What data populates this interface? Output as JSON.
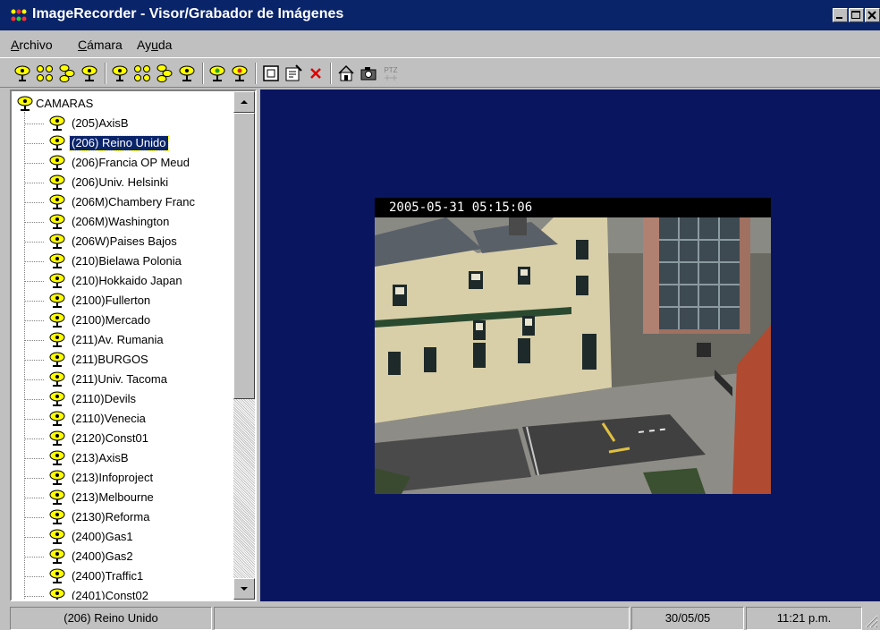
{
  "window": {
    "title": "ImageRecorder - Visor/Grabador de Imágenes",
    "icons": [
      "app-icon",
      "minimize-icon",
      "maximize-icon",
      "close-icon"
    ]
  },
  "menu": [
    {
      "label_ul": "A",
      "label_rest": "rchivo"
    },
    {
      "label_ul": "C",
      "label_rest": "ámara"
    },
    {
      "label_pre": "Ay",
      "label_ul": "u",
      "label_rest": "da"
    }
  ],
  "toolbar": {
    "buttons": [
      "camera-add-icon",
      "cameras-group-icon",
      "cameras-cascade-icon",
      "camera-single-icon",
      "camera-add-icon",
      "cameras-group-icon",
      "cameras-cascade-icon",
      "camera-single-icon",
      "camera-connect-icon",
      "camera-disconnect-icon",
      "fit-window-icon",
      "properties-icon",
      "delete-icon",
      "home-icon",
      "snapshot-icon",
      "ptz-icon"
    ],
    "ptz_label": "PTZ"
  },
  "tree": {
    "root": "CAMARAS",
    "selected": "(206) Reino Unido",
    "items": [
      "(205)AxisB",
      "(206) Reino Unido",
      "(206)Francia OP Meud",
      "(206)Univ. Helsinki",
      "(206M)Chambery Franc",
      "(206M)Washington",
      "(206W)Paises Bajos",
      "(210)Bielawa Polonia",
      "(210)Hokkaido Japan",
      "(2100)Fullerton",
      "(2100)Mercado",
      "(211)Av. Rumania",
      "(211)BURGOS",
      "(211)Univ. Tacoma",
      "(2110)Devils",
      "(2110)Venecia",
      "(2120)Const01",
      "(213)AxisB",
      "(213)Infoproject",
      "(213)Melbourne",
      "(2130)Reforma",
      "(2400)Gas1",
      "(2400)Gas2",
      "(2400)Traffic1",
      "(2401)Const02"
    ]
  },
  "viewer": {
    "timestamp": "2005-05-31  05:15:06",
    "background": "#0a1560"
  },
  "status": {
    "camera": "(206) Reino Unido",
    "date": "30/05/05",
    "time": "11:21 p.m."
  },
  "colors": {
    "titlebar": "#0a246a",
    "selection": "#0a246a",
    "camera_icon": "#ffff00"
  }
}
